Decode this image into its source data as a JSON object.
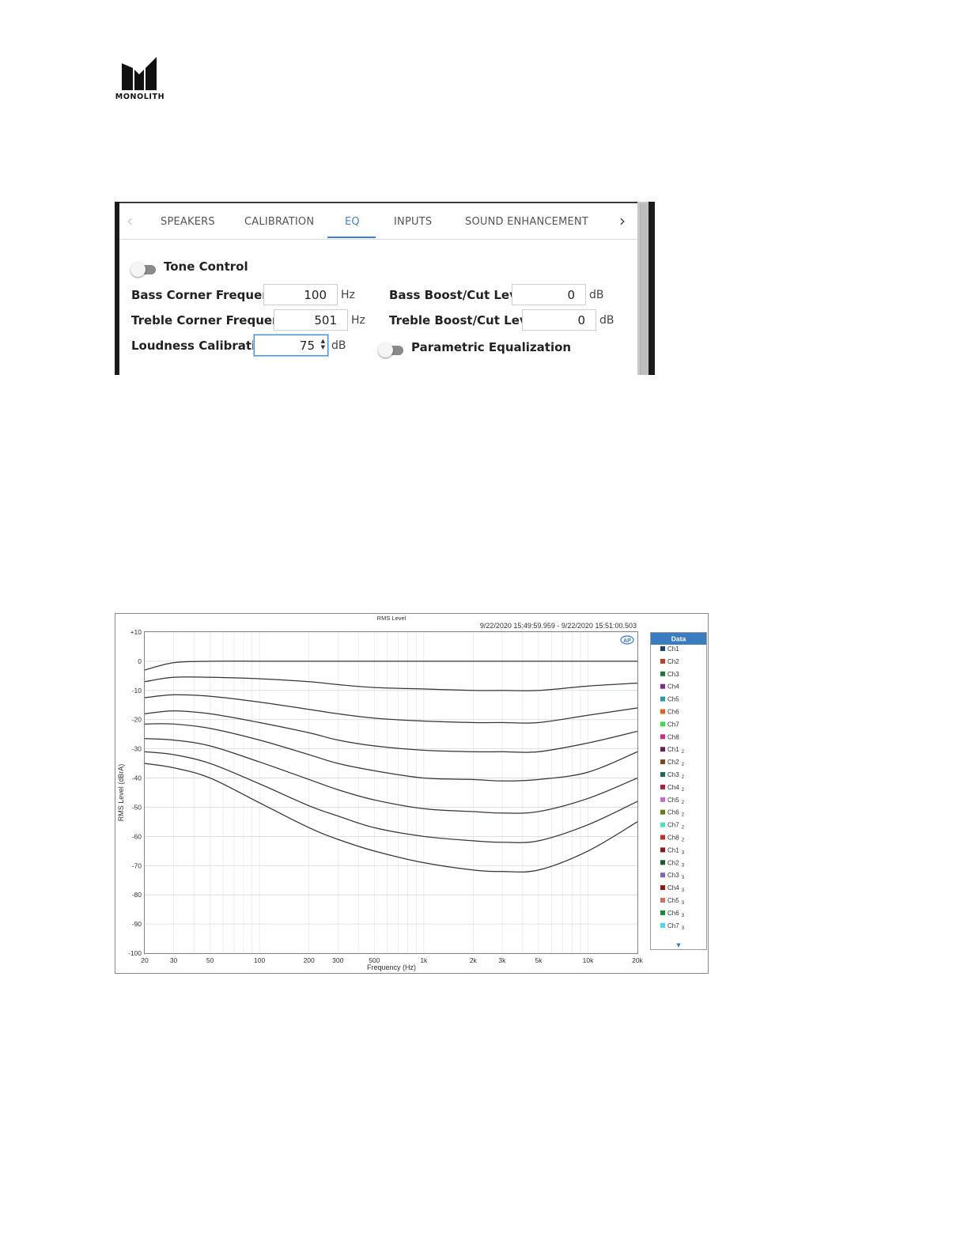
{
  "logo": {
    "text": "MONOLITH"
  },
  "ui": {
    "tabs": [
      {
        "label": "SPEAKERS",
        "active": false
      },
      {
        "label": "CALIBRATION",
        "active": false
      },
      {
        "label": "EQ",
        "active": true
      },
      {
        "label": "INPUTS",
        "active": false
      },
      {
        "label": "SOUND ENHANCEMENT",
        "active": false
      }
    ],
    "tone_control": {
      "label": "Tone Control",
      "on": false
    },
    "bass_corner": {
      "label": "Bass Corner Frequency:",
      "value": "100",
      "unit": "Hz"
    },
    "treble_corner": {
      "label": "Treble Corner Frequency:",
      "value": "501",
      "unit": "Hz"
    },
    "loudness": {
      "label": "Loudness Calibration:",
      "value": "75",
      "unit": "dB"
    },
    "bass_boost": {
      "label": "Bass Boost/Cut Level:",
      "value": "0",
      "unit": "dB"
    },
    "treble_boost": {
      "label": "Treble Boost/Cut Level:",
      "value": "0",
      "unit": "dB"
    },
    "parametric_eq": {
      "label": "Parametric Equalization",
      "on": false
    },
    "accent_color": "#3f7fdc"
  },
  "chart_data": {
    "type": "line",
    "title": "RMS Level",
    "timestamp": "9/22/2020 15:49:59.959 -   9/22/2020 15:51:00.503",
    "xlabel": "Frequency (Hz)",
    "ylabel": "RMS Level (dBrA)",
    "x_scale": "log",
    "xlim": [
      20,
      20000
    ],
    "ylim": [
      -100,
      10
    ],
    "x_ticks": [
      20,
      30,
      50,
      100,
      200,
      300,
      500,
      1000,
      2000,
      3000,
      5000,
      10000,
      20000
    ],
    "x_tick_labels": [
      "20",
      "30",
      "50",
      "100",
      "200",
      "300",
      "500",
      "1k",
      "2k",
      "3k",
      "5k",
      "10k",
      "20k"
    ],
    "y_ticks": [
      10,
      0,
      -10,
      -20,
      -30,
      -40,
      -50,
      -60,
      -70,
      -80,
      -90,
      -100
    ],
    "y_tick_labels": [
      "+10",
      "0",
      "-10",
      "-20",
      "-30",
      "-40",
      "-50",
      "-60",
      "-70",
      "-80",
      "-90",
      "-100"
    ],
    "grid": true,
    "legend": {
      "title": "Data",
      "placement": "right",
      "items": [
        {
          "label": "Ch1",
          "sub": "",
          "color": "#1f3f7a"
        },
        {
          "label": "Ch2",
          "sub": "",
          "color": "#c0392b"
        },
        {
          "label": "Ch3",
          "sub": "",
          "color": "#1e7b34"
        },
        {
          "label": "Ch4",
          "sub": "",
          "color": "#7b2d8b"
        },
        {
          "label": "Ch5",
          "sub": "",
          "color": "#2a9aa8"
        },
        {
          "label": "Ch6",
          "sub": "",
          "color": "#e0601e"
        },
        {
          "label": "Ch7",
          "sub": "",
          "color": "#3fdc4a"
        },
        {
          "label": "Ch8",
          "sub": "",
          "color": "#d02a8a"
        },
        {
          "label": "Ch1",
          "sub": "2",
          "color": "#6b1f5a"
        },
        {
          "label": "Ch2",
          "sub": "2",
          "color": "#7a4a16"
        },
        {
          "label": "Ch3",
          "sub": "2",
          "color": "#1d6a5a"
        },
        {
          "label": "Ch4",
          "sub": "2",
          "color": "#b01f3a"
        },
        {
          "label": "Ch5",
          "sub": "2",
          "color": "#c46ac8"
        },
        {
          "label": "Ch6",
          "sub": "2",
          "color": "#6a7a16"
        },
        {
          "label": "Ch7",
          "sub": "2",
          "color": "#4ee0c0"
        },
        {
          "label": "Ch8",
          "sub": "2",
          "color": "#c0302a"
        },
        {
          "label": "Ch1",
          "sub": "3",
          "color": "#8a1a1a"
        },
        {
          "label": "Ch2",
          "sub": "3",
          "color": "#1a5a2a"
        },
        {
          "label": "Ch3",
          "sub": "3",
          "color": "#7a6ab8"
        },
        {
          "label": "Ch4",
          "sub": "3",
          "color": "#8a1a10"
        },
        {
          "label": "Ch5",
          "sub": "3",
          "color": "#d07060"
        },
        {
          "label": "Ch6",
          "sub": "3",
          "color": "#1a8a3a"
        },
        {
          "label": "Ch7",
          "sub": "3",
          "color": "#4ad8e8"
        }
      ]
    },
    "series": [
      {
        "x": [
          20,
          30,
          50,
          100,
          200,
          300,
          500,
          1000,
          2000,
          3000,
          5000,
          10000,
          20000
        ],
        "y": [
          -3,
          -0.5,
          0,
          0,
          0,
          0,
          0,
          0,
          0,
          0,
          0,
          0,
          0
        ]
      },
      {
        "x": [
          20,
          30,
          50,
          100,
          200,
          300,
          500,
          1000,
          2000,
          3000,
          5000,
          10000,
          20000
        ],
        "y": [
          -7,
          -5.5,
          -5.5,
          -6,
          -7,
          -8,
          -9,
          -9.5,
          -10,
          -10,
          -10,
          -8.5,
          -7.5
        ]
      },
      {
        "x": [
          20,
          30,
          50,
          100,
          200,
          300,
          500,
          1000,
          2000,
          3000,
          5000,
          10000,
          20000
        ],
        "y": [
          -12.5,
          -11.5,
          -12,
          -14,
          -16.5,
          -18,
          -19.5,
          -20.5,
          -21,
          -21,
          -21,
          -18.5,
          -16
        ]
      },
      {
        "x": [
          20,
          30,
          50,
          100,
          200,
          300,
          500,
          1000,
          2000,
          3000,
          5000,
          10000,
          20000
        ],
        "y": [
          -18,
          -17,
          -18,
          -21,
          -24.5,
          -27,
          -29,
          -30.5,
          -31,
          -31,
          -31,
          -28,
          -24
        ]
      },
      {
        "x": [
          20,
          30,
          50,
          100,
          200,
          300,
          500,
          1000,
          2000,
          3000,
          5000,
          10000,
          20000
        ],
        "y": [
          -21.5,
          -21.5,
          -23,
          -27,
          -32,
          -35,
          -37.5,
          -40,
          -40.5,
          -41,
          -40.5,
          -38,
          -31
        ]
      },
      {
        "x": [
          20,
          30,
          50,
          100,
          200,
          300,
          500,
          1000,
          2000,
          3000,
          5000,
          10000,
          20000
        ],
        "y": [
          -26.5,
          -27,
          -29,
          -34.5,
          -40.5,
          -44,
          -47.5,
          -50.5,
          -51.5,
          -52,
          -51.5,
          -47,
          -40
        ]
      },
      {
        "x": [
          20,
          30,
          50,
          100,
          200,
          300,
          500,
          1000,
          2000,
          3000,
          5000,
          10000,
          20000
        ],
        "y": [
          -31,
          -32,
          -35,
          -42,
          -49.5,
          -53,
          -57,
          -60,
          -61.5,
          -62,
          -61.5,
          -56,
          -48
        ]
      },
      {
        "x": [
          20,
          30,
          50,
          100,
          200,
          300,
          500,
          1000,
          2000,
          3000,
          5000,
          10000,
          20000
        ],
        "y": [
          -35,
          -36.5,
          -40,
          -48.5,
          -57,
          -61,
          -65,
          -69,
          -71.5,
          -72,
          -71.5,
          -65,
          -55
        ]
      }
    ]
  }
}
